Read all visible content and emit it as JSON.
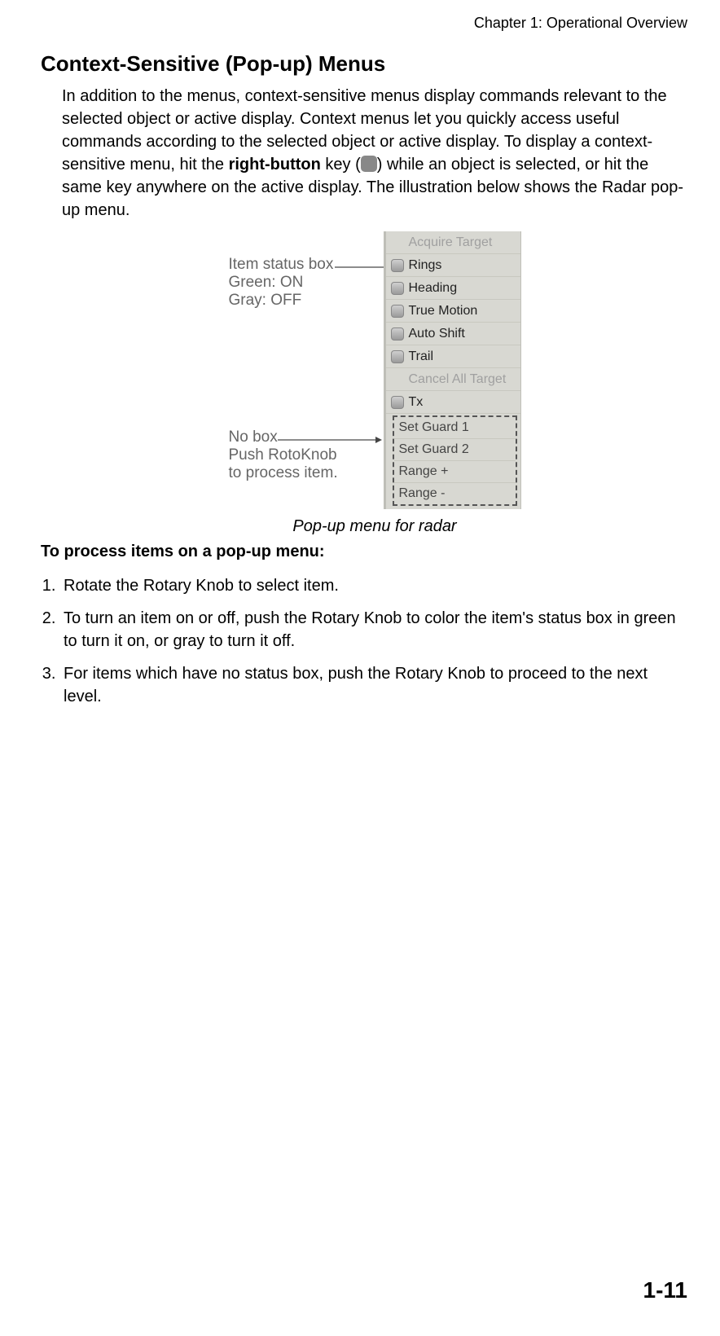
{
  "header": {
    "chapter": "Chapter 1: Operational Overview"
  },
  "title": "Context-Sensitive (Pop-up) Menus",
  "para1a": "In addition to the menus, context-sensitive menus display commands relevant to the selected object or active display. Context menus let you quickly access useful commands according to the selected object or active display. To display a context-sensitive menu, hit the ",
  "boldkey": "right-button",
  "para1b": " key (",
  "para1c": ") while an object is selected, or hit the same key anywhere on the active display. The illustration below shows the Radar pop-up menu.",
  "annot1": {
    "l1": "Item status box",
    "l2": "Green: ON",
    "l3": "Gray: OFF"
  },
  "annot2": {
    "l1": "No box",
    "l2": "Push RotoKnob",
    "l3": "to process item."
  },
  "menu": {
    "acquire": "Acquire Target",
    "rings": "Rings",
    "heading": "Heading",
    "truemotion": "True Motion",
    "autoshift": "Auto Shift",
    "trail": "Trail",
    "cancelall": "Cancel All Target",
    "tx": "Tx",
    "dashed": {
      "g1": "Set Guard 1",
      "g2": "Set Guard 2",
      "rplus": "Range +",
      "rminus": "Range -"
    }
  },
  "caption": "Pop-up menu for radar",
  "subhead": "To process items on a pop-up menu:",
  "steps": {
    "s1": "Rotate the Rotary Knob to select item.",
    "s2": "To turn an item on or off, push the Rotary Knob to color the item's status box in green to turn it on, or gray to turn it off.",
    "s3": "For items which have no status box, push the Rotary Knob to proceed to the next level."
  },
  "pagenum": "1-11"
}
